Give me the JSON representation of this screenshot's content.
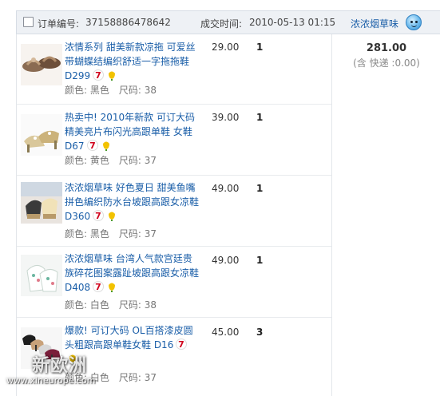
{
  "order": {
    "order_no_label": "订单编号:",
    "order_no": "37158886478642",
    "time_label": "成交时间:",
    "time": "2010-05-13 01:15",
    "seller": "浓浓烟草味",
    "total": "281.00",
    "shipping": "(含 快递 :0.00)"
  },
  "items": [
    {
      "title": "浓情系列 甜美新款凉拖 可爱丝带蝴蝶结编织舒适一字拖拖鞋 D299",
      "color": "颜色: 黑色",
      "size": "尺码: 38",
      "price": "29.00",
      "qty": "1"
    },
    {
      "title": "热卖中! 2010年新款 可订大码 精美亮片布闪光高跟单鞋 女鞋 D67",
      "color": "颜色: 黄色",
      "size": "尺码: 37",
      "price": "39.00",
      "qty": "1"
    },
    {
      "title": "浓浓烟草味 好色夏日 甜美鱼嘴拼色编织防水台坡跟高跟女凉鞋D360",
      "color": "颜色: 黑色",
      "size": "尺码: 37",
      "price": "49.00",
      "qty": "1"
    },
    {
      "title": "浓浓烟草味 台湾人气款宫廷贵族碎花图案露趾坡跟高跟女凉鞋 D408",
      "color": "颜色: 白色",
      "size": "尺码: 38",
      "price": "49.00",
      "qty": "1"
    },
    {
      "title": "爆款! 可订大码 OL百搭漆皮圆头粗跟高跟单鞋女鞋 D16",
      "color": "颜色: 白色",
      "size": "尺码: 37",
      "price": "45.00",
      "qty": "3"
    }
  ],
  "watermark": {
    "brand": "新欧洲",
    "url": "www.xineurope.com"
  },
  "colors": {
    "link": "#1a5ea8",
    "header_bg": "#eef1f5",
    "border": "#e2e6ea"
  }
}
